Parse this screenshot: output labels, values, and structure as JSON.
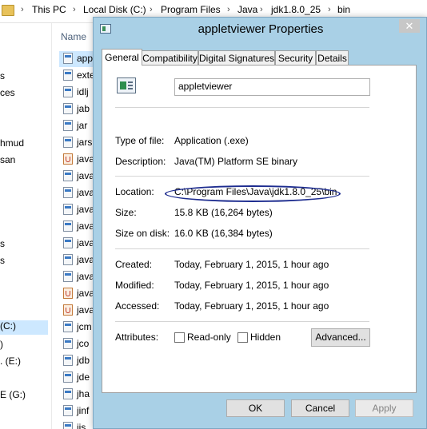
{
  "explorer": {
    "breadcrumb": [
      "This PC",
      "Local Disk (C:)",
      "Program Files",
      "Java",
      "jdk1.8.0_25",
      "bin"
    ],
    "column_header": "Name",
    "nav_items": [
      "s",
      "ces",
      "hmud",
      "san",
      "s",
      "s",
      "(C:)",
      ")",
      ". (E:)",
      "E (G:)"
    ],
    "files": [
      {
        "name": "app",
        "icon": "exe-icon"
      },
      {
        "name": "exte",
        "icon": "exe-icon"
      },
      {
        "name": "idlj",
        "icon": "exe-icon"
      },
      {
        "name": "jab",
        "icon": "exe-icon"
      },
      {
        "name": "jar",
        "icon": "exe-icon"
      },
      {
        "name": "jars",
        "icon": "exe-icon"
      },
      {
        "name": "java",
        "icon": "java-icon"
      },
      {
        "name": "java",
        "icon": "exe-icon"
      },
      {
        "name": "java",
        "icon": "exe-icon"
      },
      {
        "name": "java",
        "icon": "exe-icon"
      },
      {
        "name": "java",
        "icon": "exe-icon"
      },
      {
        "name": "java",
        "icon": "exe-icon"
      },
      {
        "name": "java",
        "icon": "exe-icon"
      },
      {
        "name": "java",
        "icon": "exe-icon"
      },
      {
        "name": "java",
        "icon": "java-icon"
      },
      {
        "name": "java",
        "icon": "java-icon"
      },
      {
        "name": "jcm",
        "icon": "exe-icon"
      },
      {
        "name": "jco",
        "icon": "exe-icon"
      },
      {
        "name": "jdb",
        "icon": "exe-icon"
      },
      {
        "name": "jde",
        "icon": "exe-icon"
      },
      {
        "name": "jha",
        "icon": "exe-icon"
      },
      {
        "name": "jinf",
        "icon": "exe-icon"
      },
      {
        "name": "jjs",
        "icon": "exe-icon"
      }
    ]
  },
  "dialog": {
    "title": "appletviewer Properties",
    "close_glyph": "✕",
    "tabs": [
      "General",
      "Compatibility",
      "Digital Signatures",
      "Security",
      "Details"
    ],
    "file_name": "appletviewer",
    "type_label": "Type of file:",
    "type_value": "Application (.exe)",
    "description_label": "Description:",
    "description_value": "Java(TM) Platform SE binary",
    "location_label": "Location:",
    "location_value": "C:\\Program Files\\Java\\jdk1.8.0_25\\bin",
    "size_label": "Size:",
    "size_value": "15.8 KB (16,264 bytes)",
    "size_on_disk_label": "Size on disk:",
    "size_on_disk_value": "16.0 KB (16,384 bytes)",
    "created_label": "Created:",
    "created_value": "Today, February 1, 2015, 1 hour ago",
    "modified_label": "Modified:",
    "modified_value": "Today, February 1, 2015, 1 hour ago",
    "accessed_label": "Accessed:",
    "accessed_value": "Today, February 1, 2015, 1 hour ago",
    "attributes_label": "Attributes:",
    "readonly_label": "Read-only",
    "hidden_label": "Hidden",
    "advanced_label": "Advanced...",
    "ok_label": "OK",
    "cancel_label": "Cancel",
    "apply_label": "Apply"
  },
  "colors": {
    "dialog_frame": "#a9d0e6",
    "selection": "#cde8ff",
    "annotation_ellipse": "#1d2c8f"
  }
}
